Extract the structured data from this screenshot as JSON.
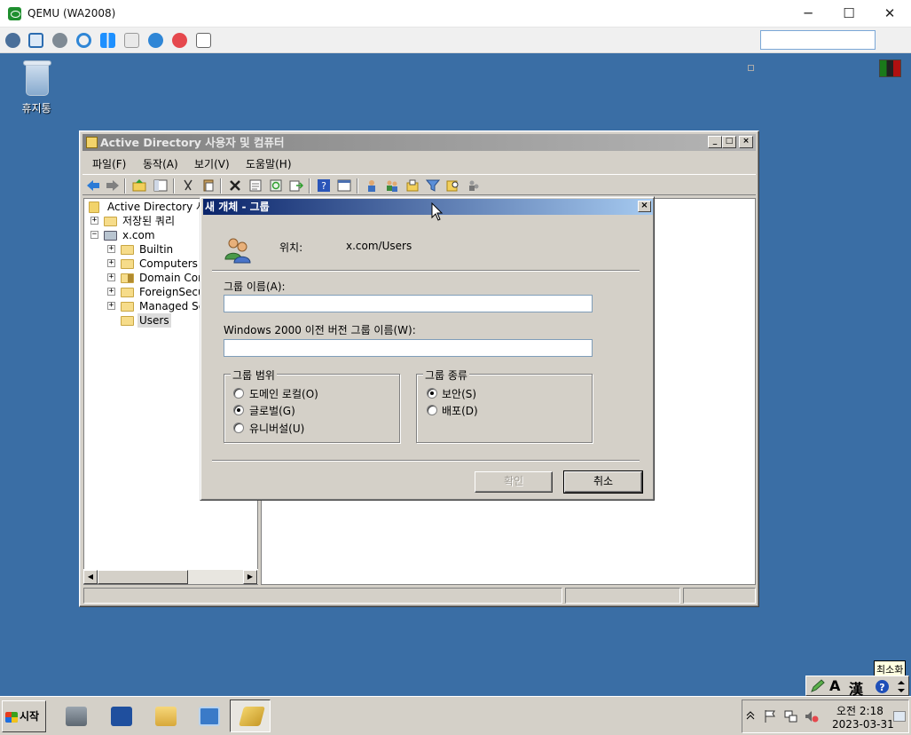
{
  "host": {
    "title": "QEMU (WA2008)",
    "controls": {
      "minimize": "─",
      "maximize": "☐",
      "close": "✕"
    }
  },
  "desktop": {
    "recycle_bin_label": "휴지통"
  },
  "aduc": {
    "title": "Active Directory 사용자 및 컴퓨터",
    "menu": [
      "파일(F)",
      "동작(A)",
      "보기(V)",
      "도움말(H)"
    ],
    "tree": [
      {
        "label": "Active Directory 사",
        "indent": 0,
        "expander": "",
        "icon": "snapin"
      },
      {
        "label": "저장된 쿼리",
        "indent": 1,
        "expander": "+",
        "icon": "folder"
      },
      {
        "label": "x.com",
        "indent": 1,
        "expander": "−",
        "icon": "domain"
      },
      {
        "label": "Builtin",
        "indent": 2,
        "expander": "+",
        "icon": "folder"
      },
      {
        "label": "Computers",
        "indent": 2,
        "expander": "+",
        "icon": "folder"
      },
      {
        "label": "Domain Cor",
        "indent": 2,
        "expander": "+",
        "icon": "ou"
      },
      {
        "label": "ForeignSecu",
        "indent": 2,
        "expander": "+",
        "icon": "folder"
      },
      {
        "label": "Managed Se",
        "indent": 2,
        "expander": "+",
        "icon": "folder"
      },
      {
        "label": "Users",
        "indent": 2,
        "expander": "",
        "icon": "folder",
        "selected": true
      }
    ]
  },
  "dialog": {
    "title": "새 개체 - 그룹",
    "location_label": "위치:",
    "location_value": "x.com/Users",
    "group_name_label": "그룹 이름(A):",
    "group_name_value": "",
    "pre2000_label": "Windows 2000 이전 버전 그룹 이름(W):",
    "pre2000_value": "",
    "scope": {
      "legend": "그룹 범위",
      "options": [
        "도메인 로컬(O)",
        "글로벌(G)",
        "유니버설(U)"
      ],
      "selected": "글로벌(G)"
    },
    "type": {
      "legend": "그룹 종류",
      "options": [
        "보안(S)",
        "배포(D)"
      ],
      "selected": "보안(S)"
    },
    "ok_label": "확인",
    "cancel_label": "취소"
  },
  "ime": {
    "tooltip": "최소화",
    "mode": "A",
    "hanja": "漢"
  },
  "taskbar": {
    "start_label": "시작",
    "clock_time": "오전 2:18",
    "clock_date": "2023-03-31"
  }
}
